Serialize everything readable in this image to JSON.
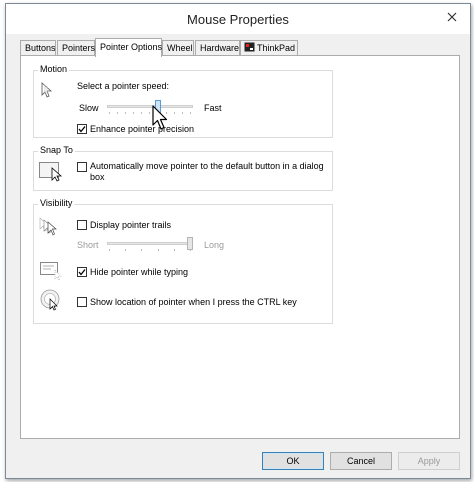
{
  "window": {
    "title": "Mouse Properties"
  },
  "tabs": [
    {
      "label": "Buttons",
      "active": false
    },
    {
      "label": "Pointers",
      "active": false
    },
    {
      "label": "Pointer Options",
      "active": true
    },
    {
      "label": "Wheel",
      "active": false
    },
    {
      "label": "Hardware",
      "active": false
    },
    {
      "label": "ThinkPad",
      "active": false
    }
  ],
  "motion": {
    "title": "Motion",
    "speed_label": "Select a pointer speed:",
    "slow": "Slow",
    "fast": "Fast",
    "speed_value": 0.6,
    "enhance_label": "Enhance pointer precision",
    "enhance_checked": true
  },
  "snap": {
    "title": "Snap To",
    "label": "Automatically move pointer to the default button in a dialog box",
    "checked": false
  },
  "visibility": {
    "title": "Visibility",
    "trails_label": "Display pointer trails",
    "trails_checked": false,
    "short": "Short",
    "long": "Long",
    "trails_value": 1.0,
    "hide_label": "Hide pointer while typing",
    "hide_checked": true,
    "ctrl_label": "Show location of pointer when I press the CTRL key",
    "ctrl_checked": false
  },
  "buttons": {
    "ok": "OK",
    "cancel": "Cancel",
    "apply": "Apply"
  },
  "colors": {
    "accent": "#3c7fb1",
    "thumb": "#cde6f7"
  }
}
